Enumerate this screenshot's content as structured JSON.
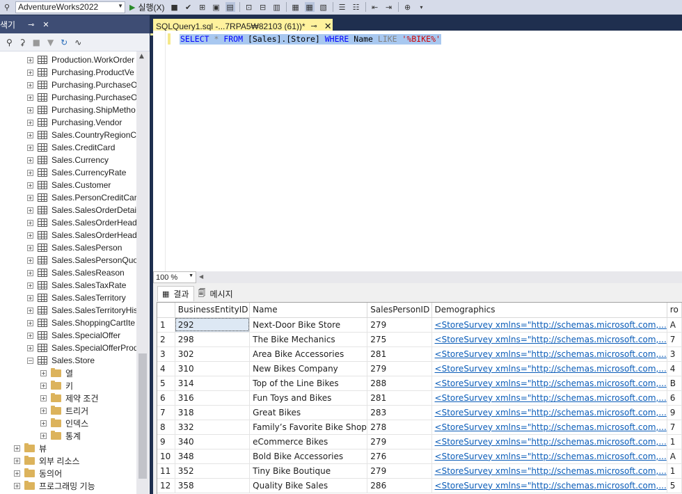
{
  "toolbar": {
    "database": "AdventureWorks2022",
    "execute_label": "실행(X)"
  },
  "explorer": {
    "title": "색기",
    "pin": "ꟷ",
    "close": "✕"
  },
  "tree": {
    "tables": [
      "Production.WorkOrder",
      "Purchasing.ProductVe",
      "Purchasing.PurchaseO",
      "Purchasing.PurchaseO",
      "Purchasing.ShipMetho",
      "Purchasing.Vendor",
      "Sales.CountryRegionC",
      "Sales.CreditCard",
      "Sales.Currency",
      "Sales.CurrencyRate",
      "Sales.Customer",
      "Sales.PersonCreditCar",
      "Sales.SalesOrderDetail",
      "Sales.SalesOrderHeade",
      "Sales.SalesOrderHeade",
      "Sales.SalesPerson",
      "Sales.SalesPersonQuot",
      "Sales.SalesReason",
      "Sales.SalesTaxRate",
      "Sales.SalesTerritory",
      "Sales.SalesTerritoryHis",
      "Sales.ShoppingCartIte",
      "Sales.SpecialOffer",
      "Sales.SpecialOfferProd",
      "Sales.Store"
    ],
    "store_children": [
      "열",
      "키",
      "제약 조건",
      "트리거",
      "인덱스",
      "통계"
    ],
    "db_folders": [
      "뷰",
      "외부 리소스",
      "동의어",
      "프로그래밍 기능"
    ]
  },
  "editor": {
    "tab_title": "SQLQuery1.sql -...7RPA5₩82103 (61))*",
    "sql": {
      "kw1": "SELECT",
      "star": " * ",
      "kw2": "FROM",
      "t1": " [Sales].[Store] ",
      "kw3": "WHERE",
      "t2": " Name ",
      "like": "LIKE",
      "str": " '%BIKE%'"
    },
    "zoom": "100 %"
  },
  "results": {
    "tab_results": "결과",
    "tab_messages": "메시지",
    "columns": [
      "",
      "BusinessEntityID",
      "Name",
      "SalesPersonID",
      "Demographics",
      "ro"
    ],
    "rows": [
      [
        "1",
        "292",
        "Next-Door Bike Store",
        "279",
        "<StoreSurvey xmlns=\"http://schemas.microsoft.com,...",
        "A"
      ],
      [
        "2",
        "298",
        "The Bike Mechanics",
        "275",
        "<StoreSurvey xmlns=\"http://schemas.microsoft.com,...",
        "7"
      ],
      [
        "3",
        "302",
        "Area Bike Accessories",
        "281",
        "<StoreSurvey xmlns=\"http://schemas.microsoft.com,...",
        "3"
      ],
      [
        "4",
        "310",
        "New Bikes Company",
        "279",
        "<StoreSurvey xmlns=\"http://schemas.microsoft.com,...",
        "4"
      ],
      [
        "5",
        "314",
        "Top of the Line Bikes",
        "288",
        "<StoreSurvey xmlns=\"http://schemas.microsoft.com,...",
        "B"
      ],
      [
        "6",
        "316",
        "Fun Toys and Bikes",
        "281",
        "<StoreSurvey xmlns=\"http://schemas.microsoft.com,...",
        "6"
      ],
      [
        "7",
        "318",
        "Great Bikes",
        "283",
        "<StoreSurvey xmlns=\"http://schemas.microsoft.com,...",
        "9"
      ],
      [
        "8",
        "332",
        "Family’s Favorite Bike Shop",
        "278",
        "<StoreSurvey xmlns=\"http://schemas.microsoft.com,...",
        "7"
      ],
      [
        "9",
        "340",
        "eCommerce Bikes",
        "279",
        "<StoreSurvey xmlns=\"http://schemas.microsoft.com,...",
        "1"
      ],
      [
        "10",
        "348",
        "Bold Bike Accessories",
        "276",
        "<StoreSurvey xmlns=\"http://schemas.microsoft.com,...",
        "A"
      ],
      [
        "11",
        "352",
        "Tiny Bike Boutique",
        "279",
        "<StoreSurvey xmlns=\"http://schemas.microsoft.com,...",
        "1"
      ],
      [
        "12",
        "358",
        "Quality Bike Sales",
        "286",
        "<StoreSurvey xmlns=\"http://schemas.microsoft.com,...",
        "5"
      ]
    ]
  }
}
